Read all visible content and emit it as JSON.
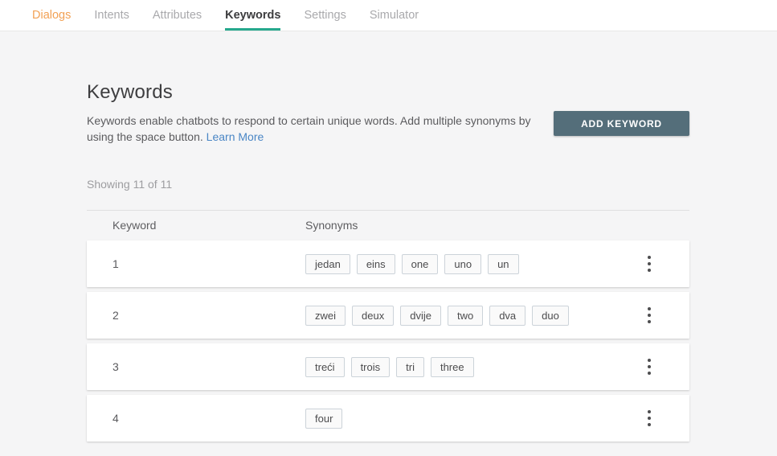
{
  "nav": {
    "tabs": [
      {
        "label": "Dialogs",
        "state": "highlight"
      },
      {
        "label": "Intents",
        "state": "normal"
      },
      {
        "label": "Attributes",
        "state": "normal"
      },
      {
        "label": "Keywords",
        "state": "active"
      },
      {
        "label": "Settings",
        "state": "normal"
      },
      {
        "label": "Simulator",
        "state": "normal"
      }
    ]
  },
  "page": {
    "title": "Keywords",
    "description": "Keywords enable chatbots to respond to certain unique words. Add multiple synonyms by using the space button.",
    "learn_more_label": "Learn More",
    "add_button_label": "ADD KEYWORD",
    "showing_text": "Showing 11 of 11"
  },
  "table": {
    "columns": [
      "Keyword",
      "Synonyms"
    ],
    "rows": [
      {
        "keyword": "1",
        "synonyms": [
          "jedan",
          "eins",
          "one",
          "uno",
          "un"
        ]
      },
      {
        "keyword": "2",
        "synonyms": [
          "zwei",
          "deux",
          "dvije",
          "two",
          "dva",
          "duo"
        ]
      },
      {
        "keyword": "3",
        "synonyms": [
          "treći",
          "trois",
          "tri",
          "three"
        ]
      },
      {
        "keyword": "4",
        "synonyms": [
          "four"
        ]
      }
    ]
  },
  "colors": {
    "accent_teal_underline": "#26a88d",
    "highlight_orange": "#f2a154",
    "button_slate": "#546e7a",
    "link_blue": "#4a86c5",
    "page_background": "#f5f5f6"
  }
}
